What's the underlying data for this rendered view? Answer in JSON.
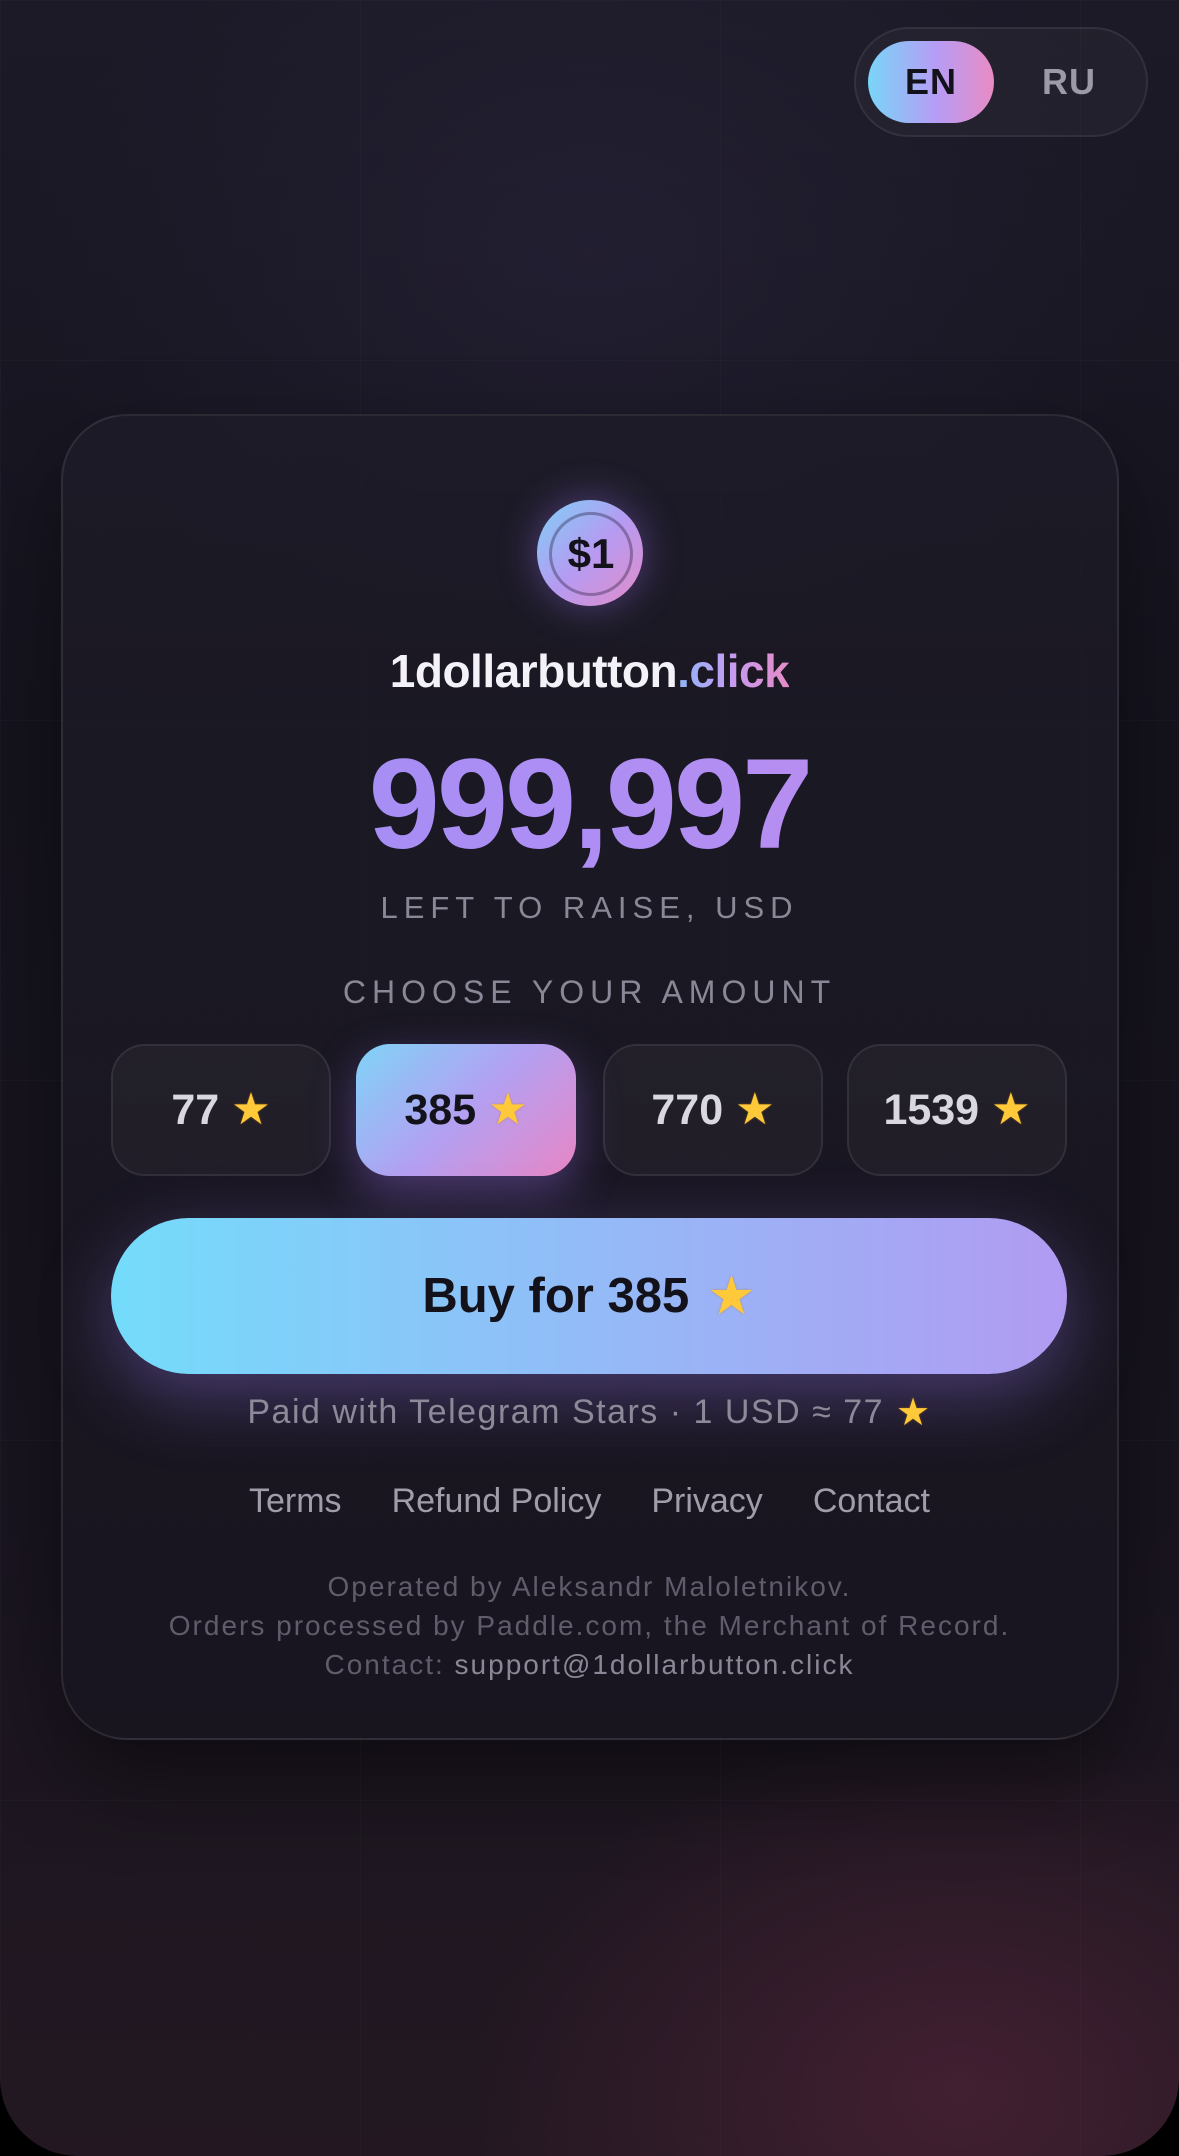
{
  "lang_switch": {
    "en": "EN",
    "ru": "RU",
    "selected": "EN"
  },
  "logo": {
    "coin_text": "$1"
  },
  "brand": {
    "name": "1dollarbutton",
    "tld": ".click"
  },
  "counter": {
    "value": "999,997",
    "label": "LEFT TO RAISE, USD"
  },
  "amounts": {
    "label": "CHOOSE YOUR AMOUNT",
    "options": [
      {
        "value": "77",
        "selected": false
      },
      {
        "value": "385",
        "selected": true
      },
      {
        "value": "770",
        "selected": false
      },
      {
        "value": "1539",
        "selected": false
      }
    ],
    "star_icon": "star-icon"
  },
  "buy_button": {
    "label": "Buy for 385"
  },
  "payment_note": {
    "text": "Paid with Telegram Stars · 1 USD ≈ 77"
  },
  "footer_links": [
    "Terms",
    "Refund Policy",
    "Privacy",
    "Contact"
  ],
  "legal": {
    "line1": "Operated by Aleksandr Maloletnikov.",
    "line2": "Orders processed by Paddle.com, the Merchant of Record.",
    "contact_prefix": "Contact:",
    "email": "support@1dollarbutton.click"
  },
  "colors": {
    "accent_cyan": "#74dcfb",
    "accent_purple": "#b19bf2",
    "accent_pink": "#e886c4",
    "background": "#17151f",
    "star": "#ffc93a"
  }
}
